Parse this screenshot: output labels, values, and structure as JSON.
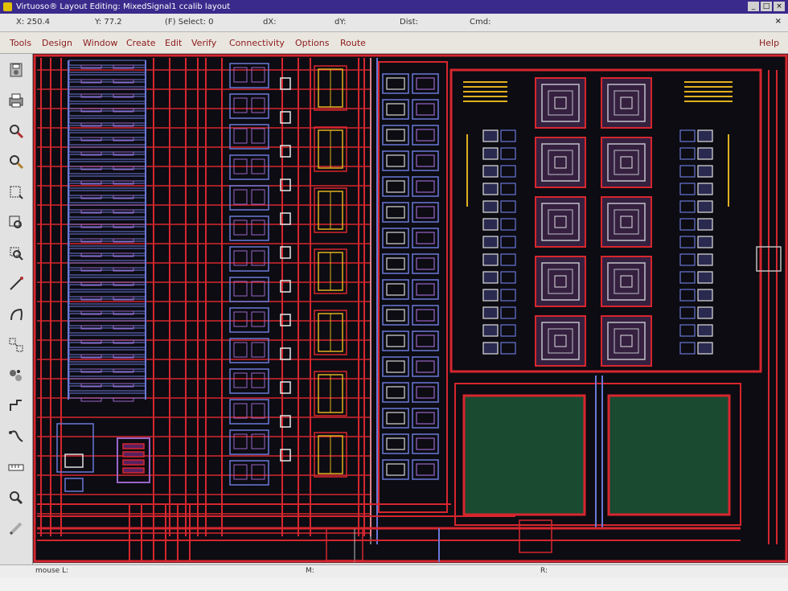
{
  "window": {
    "title": "Virtuoso® Layout Editing: MixedSignal1 ccalib layout",
    "controls": [
      "_",
      "□",
      "×"
    ]
  },
  "status": {
    "x": "X: 250.4",
    "y": "Y: 77.2",
    "sel": "(F) Select: 0",
    "dx": "dX:",
    "dy": "dY:",
    "dist": "Dist:",
    "cmd": "Cmd:",
    "close": "×"
  },
  "menu": {
    "items": [
      "Tools",
      "Design",
      "Window",
      "Create",
      "Edit",
      "Verify",
      "Connectivity",
      "Options",
      "Route"
    ],
    "help": "Help"
  },
  "toolbar": {
    "icons": [
      "save-icon",
      "print-icon",
      "zoom-in-icon",
      "zoom-out-icon",
      "fit-icon",
      "zoom-area-icon",
      "zoom-select-icon",
      "path-icon",
      "arc-icon",
      "instance-icon",
      "group-icon",
      "wire-icon",
      "probe-icon",
      "ruler-icon",
      "search-icon",
      "pencil-icon"
    ]
  },
  "bottom": {
    "mouse": "mouse L:",
    "m": "M:",
    "r": "R:"
  },
  "colors": {
    "titlebar": "#3a2a8c",
    "menu_text": "#8b1b1b",
    "canvas_bg": "#0c0c12",
    "metal_red": "#d7262e",
    "poly_blue": "#6b78d8",
    "violet": "#9a66c8",
    "yellow": "#e0b020",
    "green_fill": "#1a4a30"
  }
}
